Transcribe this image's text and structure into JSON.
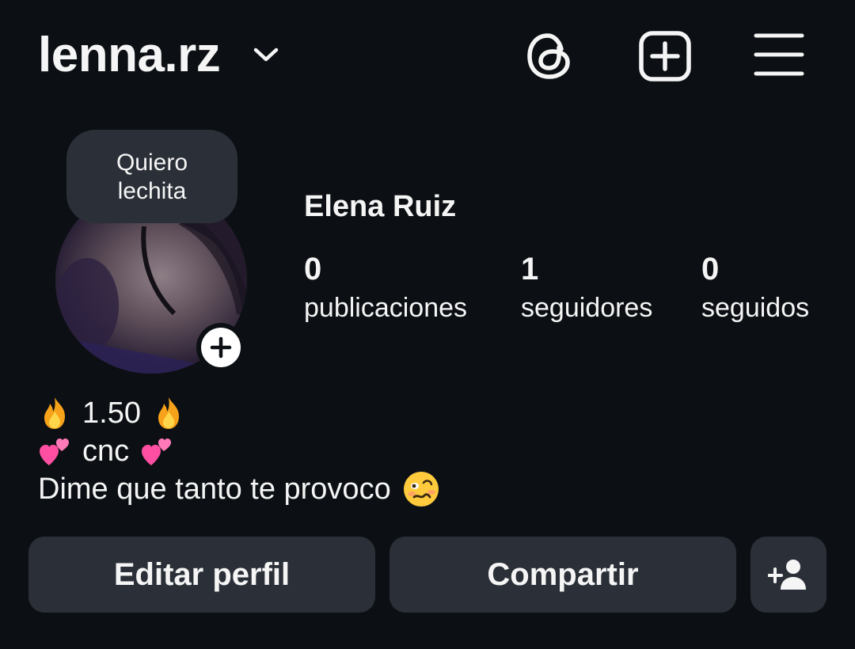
{
  "header": {
    "username": "lenna.rz",
    "icons": [
      "chevron-down-icon",
      "threads-icon",
      "new-post-icon",
      "menu-icon"
    ]
  },
  "profile": {
    "note": "Quiero lechita",
    "full_name": "Elena Ruiz",
    "stats": [
      {
        "value": "0",
        "label": "publicaciones"
      },
      {
        "value": "1",
        "label": "seguidores"
      },
      {
        "value": "0",
        "label": "seguidos"
      }
    ]
  },
  "bio": {
    "line1_text": "1.50",
    "line2_text": "cnc",
    "line3_text": "Dime que tanto te provoco",
    "emojis": [
      "fire-emoji",
      "two-hearts-emoji",
      "woozy-face-emoji"
    ]
  },
  "actions": {
    "edit_label": "Editar perfil",
    "share_label": "Compartir",
    "add_person_icon": "person-add-icon"
  },
  "colors": {
    "background": "#0c1014",
    "surface": "#2b3038",
    "text": "#f5f5f5"
  }
}
